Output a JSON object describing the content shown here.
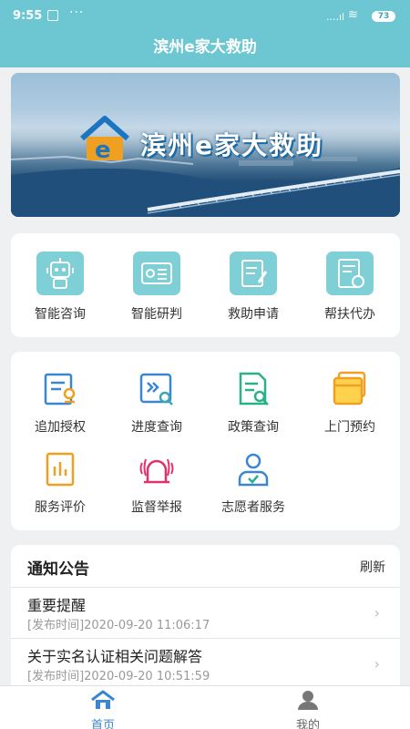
{
  "status_bar": {
    "time": "9:55",
    "dots": "···",
    "signal": "....ıl",
    "wifi": "≋",
    "battery": "73"
  },
  "header": {
    "title": "滨州e家大救助"
  },
  "banner": {
    "title": "滨州e家大救助",
    "logo_letter": "e"
  },
  "main_services": [
    {
      "label": "智能咨询",
      "icon": "robot-icon"
    },
    {
      "label": "智能研判",
      "icon": "id-card-icon"
    },
    {
      "label": "救助申请",
      "icon": "application-form-icon"
    },
    {
      "label": "帮扶代办",
      "icon": "proxy-document-icon"
    }
  ],
  "more_services": [
    {
      "label": "追加授权",
      "icon": "authorization-icon"
    },
    {
      "label": "进度查询",
      "icon": "progress-search-icon"
    },
    {
      "label": "政策查询",
      "icon": "policy-search-icon"
    },
    {
      "label": "上门预约",
      "icon": "appointment-icon"
    },
    {
      "label": "服务评价",
      "icon": "service-rating-icon"
    },
    {
      "label": "监督举报",
      "icon": "alarm-report-icon"
    },
    {
      "label": "志愿者服务",
      "icon": "volunteer-icon"
    }
  ],
  "notices": {
    "title": "通知公告",
    "refresh_label": "刷新",
    "items": [
      {
        "title": "重要提醒",
        "date": "[发布时间]2020-09-20 11:06:17"
      },
      {
        "title": "关于实名认证相关问题解答",
        "date": "[发布时间]2020-09-20 10:51:59"
      }
    ]
  },
  "tabbar": {
    "home_label": "首页",
    "mine_label": "我的"
  },
  "colors": {
    "primary": "#6cc7d3",
    "tile": "#7fcfd6",
    "tab_active": "#3a86d1",
    "tab_inactive": "#666666"
  }
}
